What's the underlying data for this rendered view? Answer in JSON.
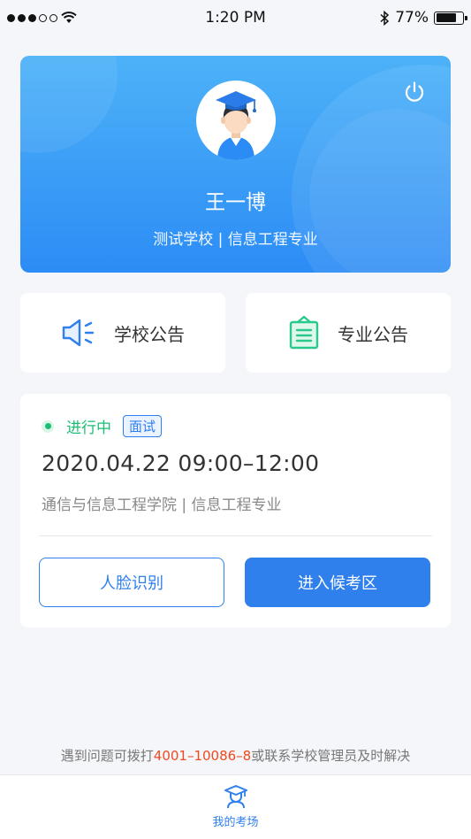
{
  "status_bar": {
    "time": "1:20 PM",
    "battery": "77%",
    "battery_level": 0.77
  },
  "profile": {
    "name": "王一博",
    "school_major": "测试学校 | 信息工程专业"
  },
  "notices": {
    "school_label": "学校公告",
    "major_label": "专业公告"
  },
  "exam": {
    "status": "进行中",
    "type_tag": "面试",
    "datetime": "2020.04.22  09:00–12:00",
    "college_major": "通信与信息工程学院 | 信息工程专业",
    "face_button": "人脸识别",
    "enter_button": "进入候考区"
  },
  "help": {
    "prefix": "遇到问题可拨打",
    "phone": "4001–10086–8",
    "suffix": "或联系学校管理员及时解决"
  },
  "tab_bar": {
    "my_exam_label": "我的考场"
  },
  "colors": {
    "primary": "#2f80ed",
    "success": "#1dbd74",
    "phone": "#f04a1e"
  }
}
